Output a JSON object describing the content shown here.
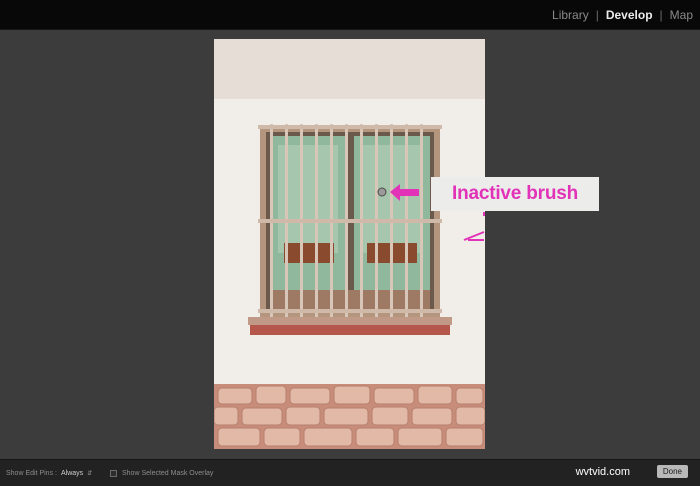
{
  "header": {
    "modules": [
      "Library",
      "Develop",
      "Map"
    ],
    "active_module": "Develop"
  },
  "canvas": {
    "annotation": "Inactive brush",
    "annotation_color": "#e233b8"
  },
  "toolbar": {
    "show_edit_pins_label": "Show Edit Pins :",
    "show_edit_pins_value": "Always",
    "mask_overlay_label": "Show Selected Mask Overlay",
    "done_label": "Done"
  },
  "watermark": "wvtvid.com"
}
